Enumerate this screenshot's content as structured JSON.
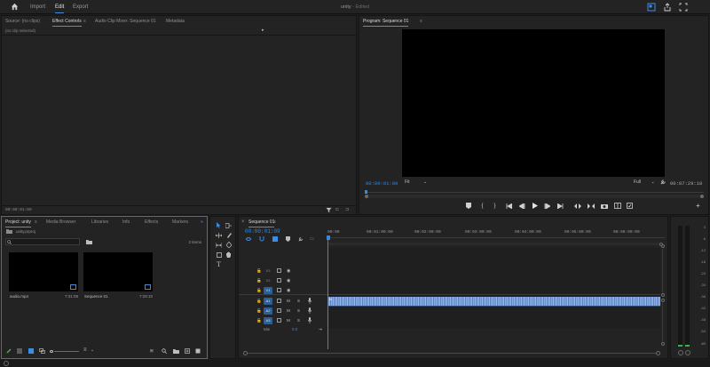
{
  "topbar": {
    "title": "unity",
    "edited": "- Edited",
    "tabs": [
      {
        "label": "Import"
      },
      {
        "label": "Edit"
      },
      {
        "label": "Export"
      }
    ]
  },
  "source_panel": {
    "tabs": [
      {
        "label": "Source: (no clips)"
      },
      {
        "label": "Effect Controls"
      },
      {
        "label": "Audio Clip Mixer: Sequence 01"
      },
      {
        "label": "Metadata"
      }
    ],
    "no_clip": "(no clip selected)",
    "timecode": "00:00:01:09"
  },
  "program_panel": {
    "title": "Program: Sequence 01",
    "timecode": "00:00:01:09",
    "fit": "Fit",
    "quality": "Full",
    "duration": "00:07:29:10"
  },
  "project_panel": {
    "tabs": [
      {
        "label": "Project: unity"
      },
      {
        "label": "Media Browser"
      },
      {
        "label": "Libraries"
      },
      {
        "label": "Info"
      },
      {
        "label": "Effects"
      },
      {
        "label": "Markers"
      }
    ],
    "file": "unity.prproj",
    "item_count": "2 items",
    "items": [
      {
        "name": "audio.mp4",
        "duration": "7:31:08"
      },
      {
        "name": "Sequence 01",
        "duration": "7:29:10"
      }
    ]
  },
  "timeline": {
    "tab": "Sequence 01",
    "timecode": "00:00:01:09",
    "ruler": [
      "00:00",
      "00:01:00:00",
      "00:02:00:00",
      "00:03:00:00",
      "00:04:00:00",
      "00:05:00:00",
      "00:06:00:00"
    ],
    "video_tracks": [
      "V3",
      "V2",
      "V1"
    ],
    "audio_tracks": [
      "A1",
      "A2",
      "A3"
    ],
    "mix_label": "Mix",
    "mix_value": "0.0",
    "track_m": "M",
    "track_s": "S",
    "track_v1": "V1",
    "track_a1": "A1",
    "clip_fx": "fx"
  },
  "meter": {
    "labels": [
      "0",
      "-6",
      "-12",
      "-18",
      "-24",
      "-30",
      "-36",
      "-42",
      "-48",
      "-54",
      "dB"
    ]
  }
}
